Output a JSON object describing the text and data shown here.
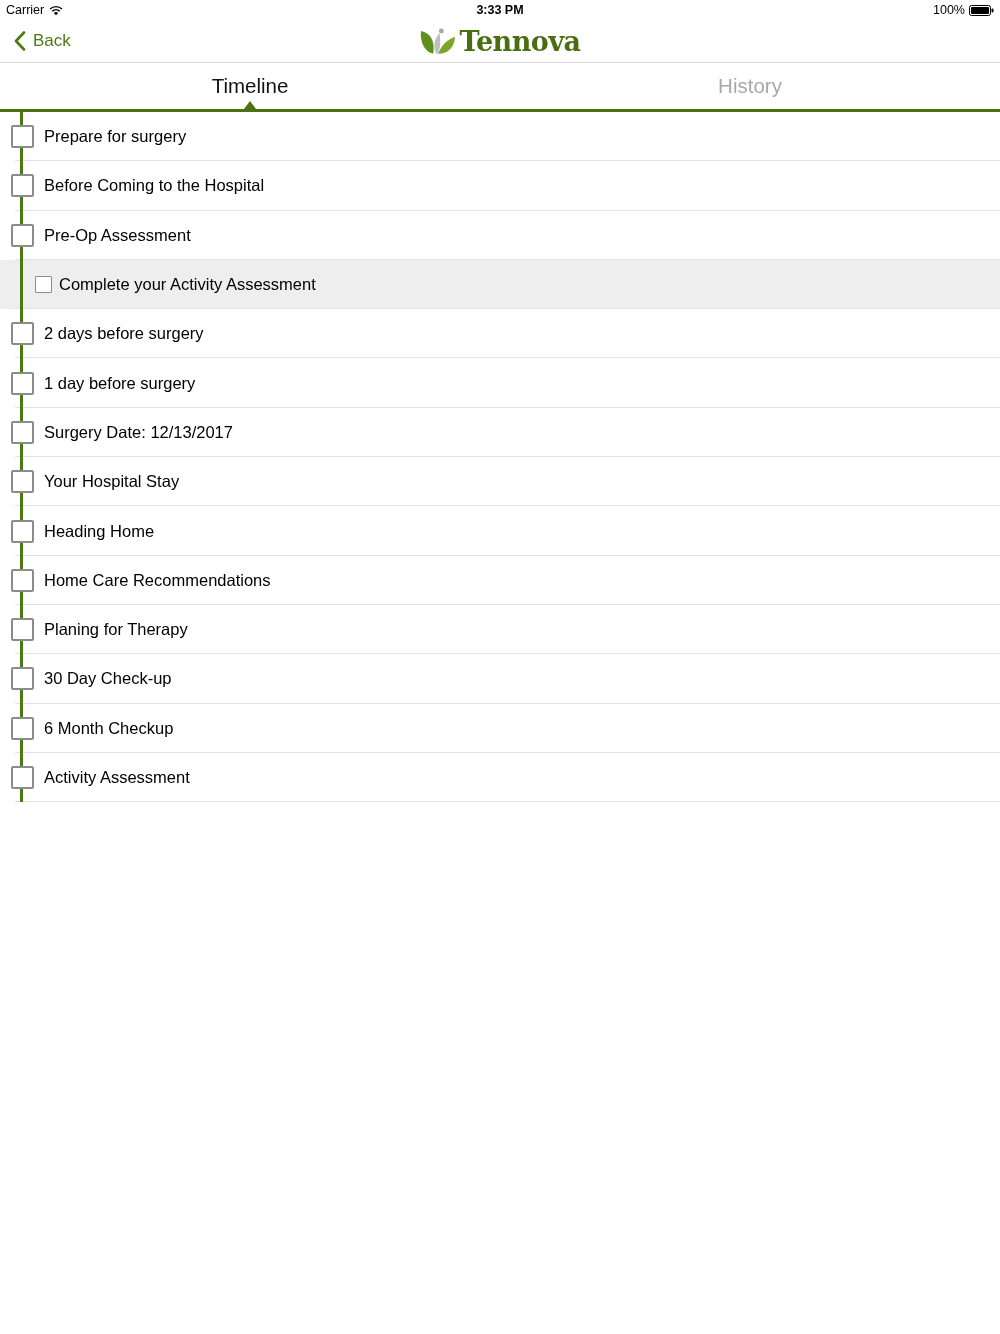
{
  "status_bar": {
    "carrier": "Carrier",
    "time": "3:33 PM",
    "battery": "100%"
  },
  "nav_bar": {
    "back": "Back",
    "logo": "Tennova"
  },
  "tabs": [
    {
      "label": "Timeline",
      "selected": true
    },
    {
      "label": "History",
      "selected": false
    }
  ],
  "timeline": [
    {
      "label": "Prepare for surgery",
      "checked": false
    },
    {
      "label": "Before Coming to the Hospital",
      "checked": false
    },
    {
      "label": "Pre-Op Assessment",
      "checked": false,
      "children": [
        {
          "label": "Complete your Activity Assessment",
          "checked": false
        }
      ]
    },
    {
      "label": "2 days before surgery",
      "checked": false
    },
    {
      "label": "1 day before surgery",
      "checked": false
    },
    {
      "label": "Surgery Date: 12/13/2017",
      "checked": false
    },
    {
      "label": "Your Hospital Stay",
      "checked": false
    },
    {
      "label": "Heading Home",
      "checked": false
    },
    {
      "label": "Home Care Recommendations",
      "checked": false
    },
    {
      "label": "Planing for Therapy",
      "checked": false
    },
    {
      "label": "30 Day Check-up",
      "checked": false
    },
    {
      "label": "6 Month Checkup",
      "checked": false
    },
    {
      "label": "Activity Assessment",
      "checked": false
    }
  ]
}
